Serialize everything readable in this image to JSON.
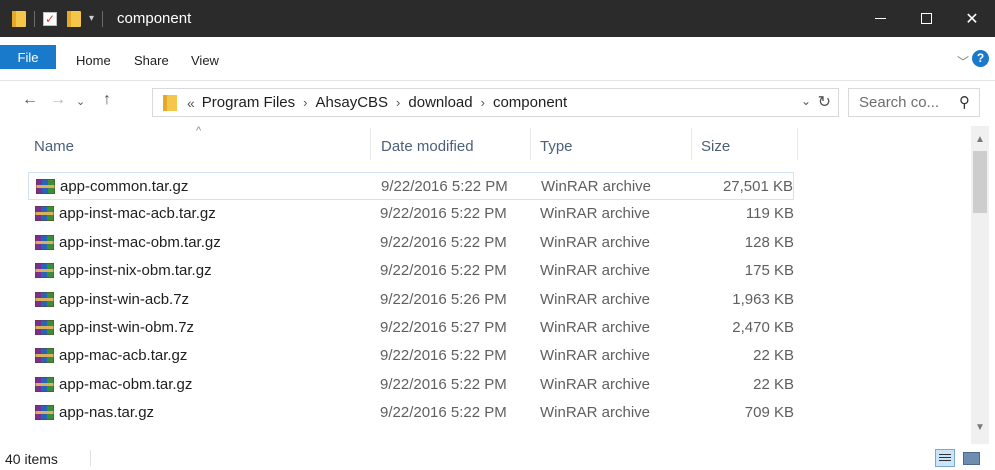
{
  "window": {
    "title": "component",
    "controls": {
      "minimize": "minimize",
      "maximize": "maximize",
      "close": "✕"
    }
  },
  "ribbon": {
    "tabs": [
      "File",
      "Home",
      "Share",
      "View"
    ]
  },
  "address": {
    "breadcrumb": [
      "Program Files",
      "AhsayCBS",
      "download",
      "component"
    ],
    "chevron": "«",
    "separator": "›"
  },
  "search": {
    "placeholder": "Search co..."
  },
  "columns": {
    "name": "Name",
    "date": "Date modified",
    "type": "Type",
    "size": "Size"
  },
  "files": [
    {
      "name": "app-common.tar.gz",
      "date": "9/22/2016 5:22 PM",
      "type": "WinRAR archive",
      "size": "27,501 KB",
      "selected": true
    },
    {
      "name": "app-inst-mac-acb.tar.gz",
      "date": "9/22/2016 5:22 PM",
      "type": "WinRAR archive",
      "size": "119 KB"
    },
    {
      "name": "app-inst-mac-obm.tar.gz",
      "date": "9/22/2016 5:22 PM",
      "type": "WinRAR archive",
      "size": "128 KB"
    },
    {
      "name": "app-inst-nix-obm.tar.gz",
      "date": "9/22/2016 5:22 PM",
      "type": "WinRAR archive",
      "size": "175 KB"
    },
    {
      "name": "app-inst-win-acb.7z",
      "date": "9/22/2016 5:26 PM",
      "type": "WinRAR archive",
      "size": "1,963 KB"
    },
    {
      "name": "app-inst-win-obm.7z",
      "date": "9/22/2016 5:27 PM",
      "type": "WinRAR archive",
      "size": "2,470 KB"
    },
    {
      "name": "app-mac-acb.tar.gz",
      "date": "9/22/2016 5:22 PM",
      "type": "WinRAR archive",
      "size": "22 KB"
    },
    {
      "name": "app-mac-obm.tar.gz",
      "date": "9/22/2016 5:22 PM",
      "type": "WinRAR archive",
      "size": "22 KB"
    },
    {
      "name": "app-nas.tar.gz",
      "date": "9/22/2016 5:22 PM",
      "type": "WinRAR archive",
      "size": "709 KB"
    }
  ],
  "status": {
    "items": "40 items"
  },
  "colors": {
    "accent": "#1979ca",
    "titlebar": "#2b2b2b",
    "folder": "#f4c64a",
    "selection": "#cfe3f7"
  },
  "icons": {
    "archive": "winrar-archive-icon",
    "folder": "folder-icon",
    "properties": "properties-checkbox-icon",
    "back": "back-arrow-icon",
    "forward": "forward-arrow-icon",
    "recent": "recent-locations-chevron-icon",
    "up": "up-arrow-icon",
    "refresh": "refresh-icon",
    "search": "magnifier-icon"
  }
}
